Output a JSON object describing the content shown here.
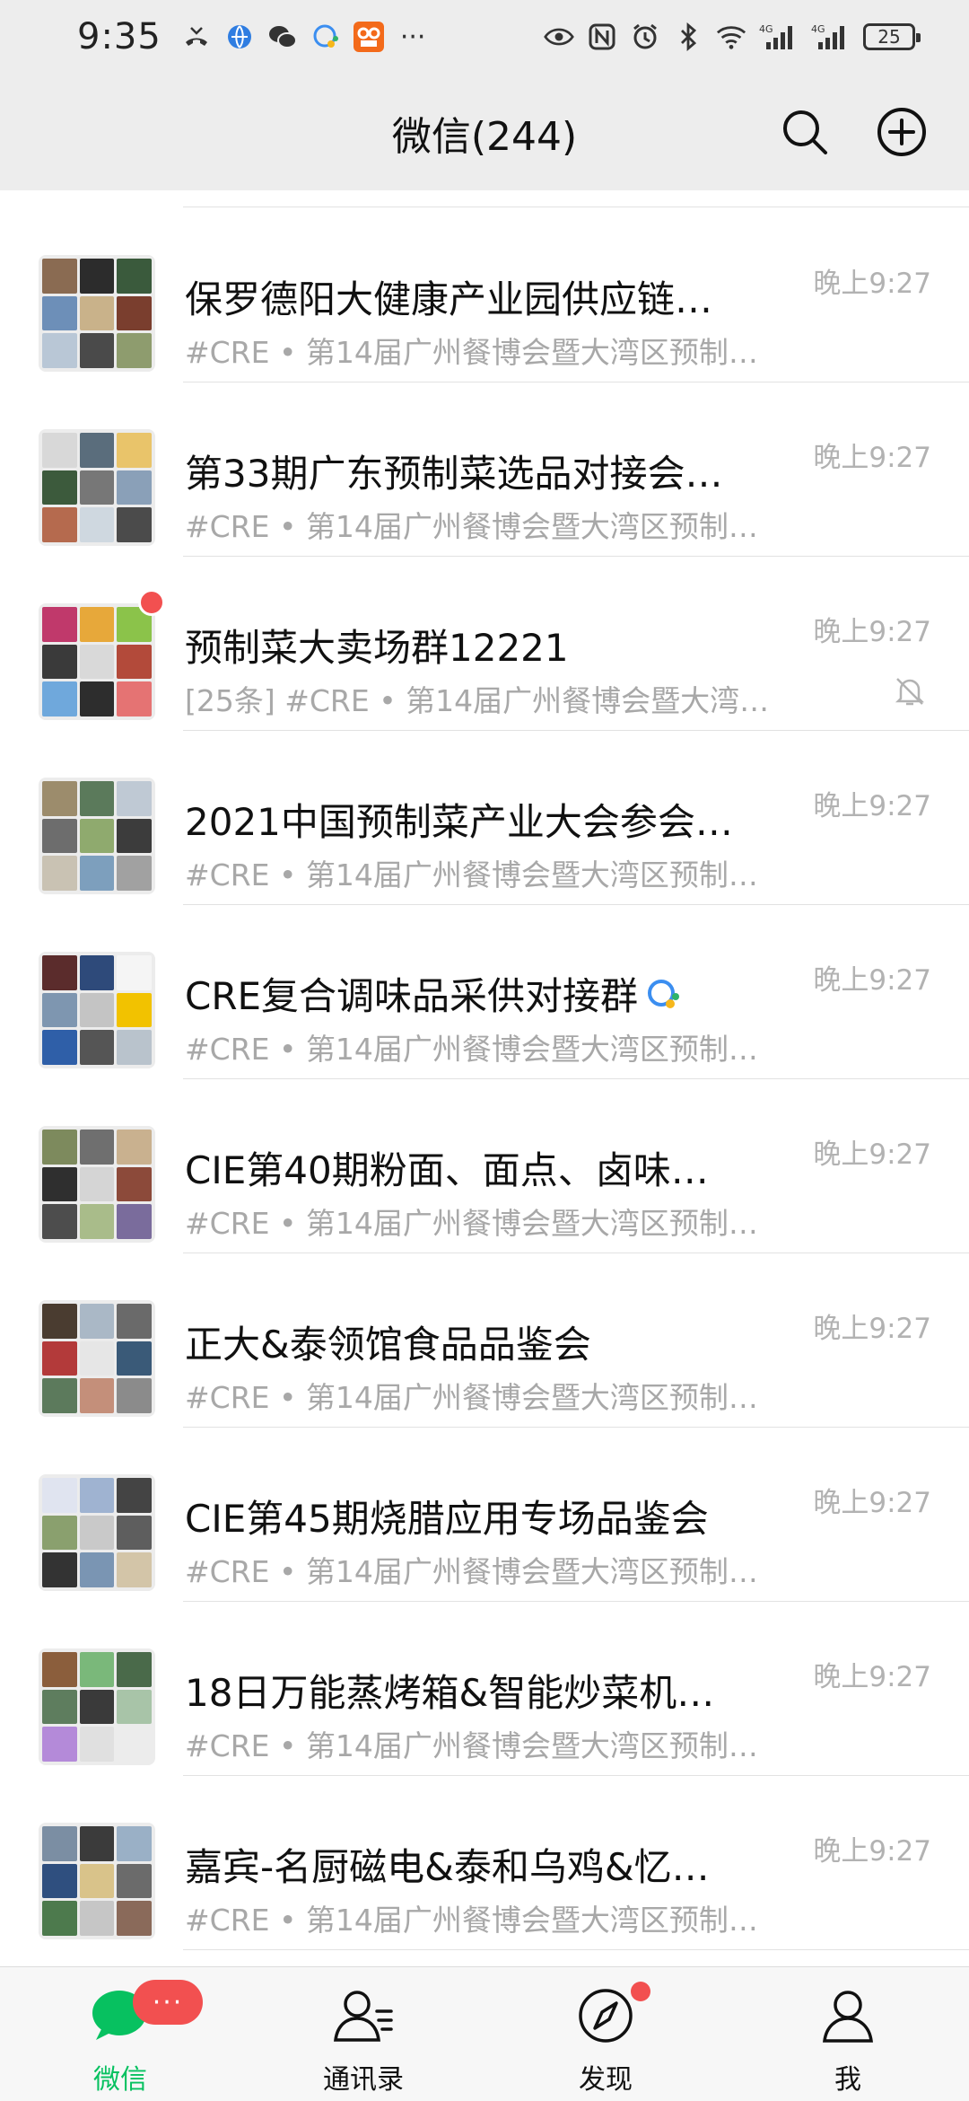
{
  "status_bar": {
    "time": "9:35",
    "battery": "25",
    "left_icons": [
      "missed-call-icon",
      "browser-icon",
      "wechat-icon",
      "chat-bubble-icon",
      "app-icon"
    ],
    "overflow": "···",
    "right_icons": [
      "eye-icon",
      "nfc-icon",
      "alarm-icon",
      "bluetooth-icon",
      "wifi-icon",
      "signal-4g-icon",
      "signal-4g-icon"
    ]
  },
  "header": {
    "title": "微信(244)",
    "search_icon": "search-icon",
    "add_icon": "add-circle-icon"
  },
  "chats": [
    {
      "title": "保罗德阳大健康产业园供应链…",
      "preview": "#CRE • 第14届广州餐博会暨大湾区预制…",
      "time": "晚上9:27",
      "unread_dot": false,
      "muted": false
    },
    {
      "title": "第33期广东预制菜选品对接会…",
      "preview": "#CRE • 第14届广州餐博会暨大湾区预制…",
      "time": "晚上9:27",
      "unread_dot": false,
      "muted": false
    },
    {
      "title": "预制菜大卖场群12221",
      "preview": "[25条] #CRE • 第14届广州餐博会暨大湾…",
      "time": "晚上9:27",
      "unread_dot": true,
      "muted": true
    },
    {
      "title": "2021中国预制菜产业大会参会…",
      "preview": "#CRE • 第14届广州餐博会暨大湾区预制…",
      "time": "晚上9:27",
      "unread_dot": false,
      "muted": false
    },
    {
      "title": "CRE复合调味品采供对接群",
      "preview": "#CRE • 第14届广州餐博会暨大湾区预制…",
      "time": "晚上9:27",
      "unread_dot": false,
      "muted": false,
      "title_icon": "enterprise-chat-icon"
    },
    {
      "title": "CIE第40期粉面、面点、卤味…",
      "preview": "#CRE • 第14届广州餐博会暨大湾区预制…",
      "time": "晚上9:27",
      "unread_dot": false,
      "muted": false
    },
    {
      "title": "正大&泰领馆食品品鉴会",
      "preview": "#CRE • 第14届广州餐博会暨大湾区预制…",
      "time": "晚上9:27",
      "unread_dot": false,
      "muted": false
    },
    {
      "title": "CIE第45期烧腊应用专场品鉴会",
      "preview": "#CRE • 第14届广州餐博会暨大湾区预制…",
      "time": "晚上9:27",
      "unread_dot": false,
      "muted": false
    },
    {
      "title": "18日万能蒸烤箱&智能炒菜机…",
      "preview": "#CRE • 第14届广州餐博会暨大湾区预制…",
      "time": "晚上9:27",
      "unread_dot": false,
      "muted": false
    },
    {
      "title": "嘉宾-名厨磁电&泰和乌鸡&忆…",
      "preview": "#CRE • 第14届广州餐博会暨大湾区预制…",
      "time": "晚上9:27",
      "unread_dot": false,
      "muted": false
    }
  ],
  "tabs": [
    {
      "label": "微信",
      "icon": "chat-bubble-icon",
      "active": true,
      "badge": "···"
    },
    {
      "label": "通讯录",
      "icon": "contacts-icon",
      "active": false
    },
    {
      "label": "发现",
      "icon": "compass-icon",
      "active": false,
      "dot": true
    },
    {
      "label": "我",
      "icon": "person-icon",
      "active": false
    }
  ],
  "colors": {
    "accent": "#07c160",
    "badge": "#f25050",
    "header_bg": "#ededed",
    "preview_text": "#a8a8a8"
  }
}
